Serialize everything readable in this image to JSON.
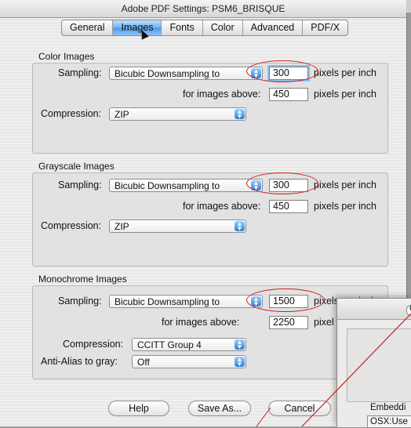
{
  "window": {
    "title": "Adobe PDF Settings: PSM6_BRISQUE"
  },
  "tabs": [
    "General",
    "Images",
    "Fonts",
    "Color",
    "Advanced",
    "PDF/X"
  ],
  "active_tab": "Images",
  "color": {
    "title": "Color Images",
    "sampling_label": "Sampling:",
    "sampling_value": "Bicubic Downsampling to",
    "ppi": "300",
    "ppi_unit": "pixels per inch",
    "above_label": "for images above:",
    "above_value": "450",
    "above_unit": "pixels per inch",
    "compression_label": "Compression:",
    "compression_value": "ZIP"
  },
  "gray": {
    "title": "Grayscale Images",
    "sampling_label": "Sampling:",
    "sampling_value": "Bicubic Downsampling to",
    "ppi": "300",
    "ppi_unit": "pixels per inch",
    "above_label": "for images above:",
    "above_value": "450",
    "above_unit": "pixels per inch",
    "compression_label": "Compression:",
    "compression_value": "ZIP"
  },
  "mono": {
    "title": "Monochrome Images",
    "sampling_label": "Sampling:",
    "sampling_value": "Bicubic Downsampling to",
    "ppi": "1500",
    "ppi_unit": "pixels per inch",
    "above_label": "for images above:",
    "above_value": "2250",
    "above_unit": "pixel",
    "compression_label": "Compression:",
    "compression_value": "CCITT Group 4",
    "antialias_label": "Anti-Alias to gray:",
    "antialias_value": "Off"
  },
  "buttons": {
    "help": "Help",
    "save_as": "Save As...",
    "cancel": "Cancel"
  },
  "overlay": {
    "button_char": "C",
    "embed_label": "Embeddi",
    "field_value": "OSX:Use"
  },
  "colors": {
    "highlight_ellipse": "#cc1f1f",
    "tab_active": "#4d97e0"
  }
}
